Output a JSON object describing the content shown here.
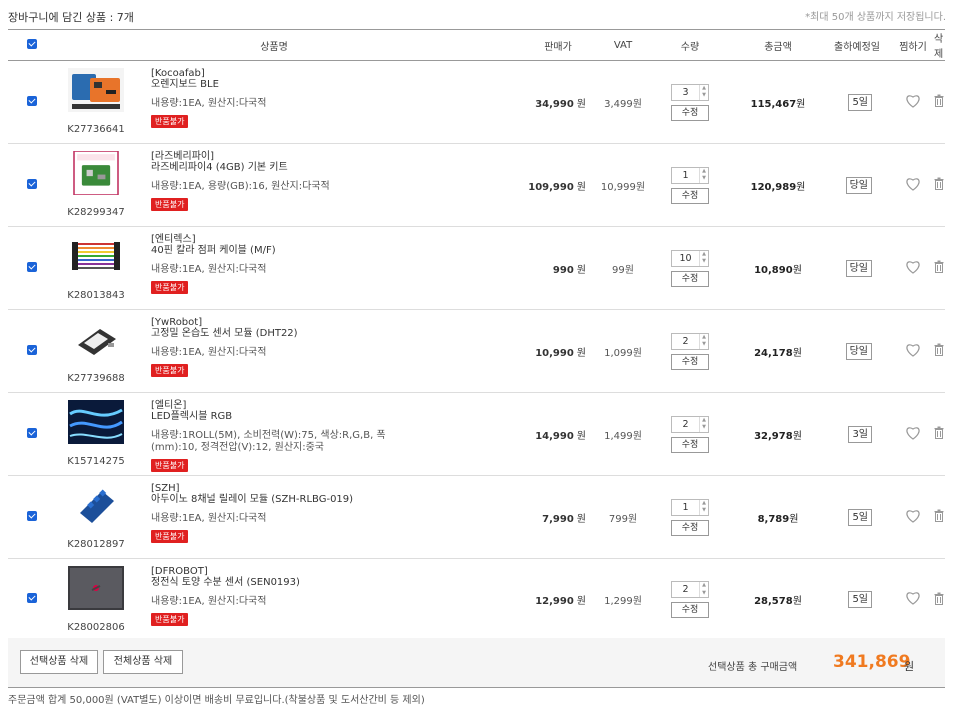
{
  "header": {
    "title": "장바구니에 담긴 상품 : 7개",
    "note": "*최대 50개 상품까지 저장됩니다."
  },
  "columns": {
    "product": "상품명",
    "price": "판매가",
    "vat": "VAT",
    "qty": "수량",
    "total": "총금액",
    "ship": "출하예정일",
    "wish": "찜하기",
    "delete": "삭제"
  },
  "labels": {
    "won": "원",
    "edit": "수정",
    "badge": "반품불가"
  },
  "items": [
    {
      "code": "K27736641",
      "brand": "[Kocoafab]",
      "name": "오렌지보드 BLE",
      "spec": "내용량:1EA, 원산지:다국적",
      "price": "34,990",
      "vat": "3,499원",
      "qty": "3",
      "total": "115,467",
      "ship": "5일",
      "thumb": "board"
    },
    {
      "code": "K28299347",
      "brand": "[라즈베리파이]",
      "name": "라즈베리파이4 (4GB) 기본 키트",
      "spec": "내용량:1EA, 용량(GB):16, 원산지:다국적",
      "price": "109,990",
      "vat": "10,999원",
      "qty": "1",
      "total": "120,989",
      "ship": "당일",
      "thumb": "rpi"
    },
    {
      "code": "K28013843",
      "brand": "[엔티렉스]",
      "name": "40핀 칼라 점퍼 케이블 (M/F)",
      "spec": "내용량:1EA, 원산지:다국적",
      "price": "990",
      "vat": "99원",
      "qty": "10",
      "total": "10,890",
      "ship": "당일",
      "thumb": "cable"
    },
    {
      "code": "K27739688",
      "brand": "[YwRobot]",
      "name": "고정밀 온습도 센서 모듈 (DHT22)",
      "spec": "내용량:1EA, 원산지:다국적",
      "price": "10,990",
      "vat": "1,099원",
      "qty": "2",
      "total": "24,178",
      "ship": "당일",
      "thumb": "sensor"
    },
    {
      "code": "K15714275",
      "brand": "[엘티온]",
      "name": "LED플렉시블 RGB",
      "spec": "내용량:1ROLL(5M), 소비전력(W):75, 색상:R,G,B, 폭(mm):10, 정격전압(V):12, 원산지:중국",
      "price": "14,990",
      "vat": "1,499원",
      "qty": "2",
      "total": "32,978",
      "ship": "3일",
      "thumb": "led"
    },
    {
      "code": "K28012897",
      "brand": "[SZH]",
      "name": "아두이노 8채널 릴레이 모듈 (SZH-RLBG-019)",
      "spec": "내용량:1EA, 원산지:다국적",
      "price": "7,990",
      "vat": "799원",
      "qty": "1",
      "total": "8,789",
      "ship": "5일",
      "thumb": "relay"
    },
    {
      "code": "K28002806",
      "brand": "[DFROBOT]",
      "name": "정전식 토양 수분 센서 (SEN0193)",
      "spec": "내용량:1EA, 원산지:다국적",
      "price": "12,990",
      "vat": "1,299원",
      "qty": "2",
      "total": "28,578",
      "ship": "5일",
      "thumb": "soil"
    }
  ],
  "footer": {
    "delete_selected": "선택상품 삭제",
    "delete_all": "전체상품 삭제",
    "sum_label": "선택상품 총 구매금액",
    "sum_value": "341,869",
    "notice": "주문금액 합계 50,000원 (VAT별도) 이상이면 배송비 무료입니다.(착불상품 및 도서산간비 등 제외)"
  },
  "colors": {
    "accent": "#f07a20",
    "checkbox": "#1a63d8",
    "badge": "#e02020"
  }
}
